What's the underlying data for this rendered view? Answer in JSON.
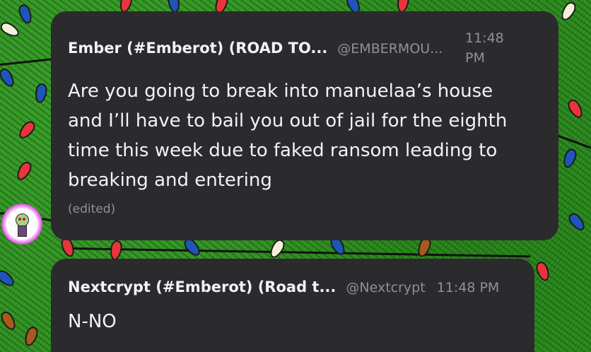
{
  "messages": [
    {
      "author": "Ember (#Emberot) (ROAD TO...",
      "handle": "@EMBERMOU...",
      "time_line1": "11:48",
      "time_line2": "PM",
      "text": "Are you going to break into manuelaa’s house and I’ll have to bail you out of jail for the eighth time this week due to faked ransom leading to breaking and entering",
      "edited": "(edited)"
    },
    {
      "author": "Nextcrypt (#Emberot) (Road t...",
      "handle": "@Nextcrypt",
      "time": "11:48 PM",
      "text": "N-NO"
    }
  ],
  "colors": {
    "card_background": "#2b2a2c",
    "author_text": "#f2f3f5",
    "muted_text": "#8e9297",
    "wallpaper_green": "#2e8a22",
    "avatar_ring": "#d43ad8"
  },
  "wallpaper": {
    "description_icon": "christmas-lights-wallpaper"
  }
}
